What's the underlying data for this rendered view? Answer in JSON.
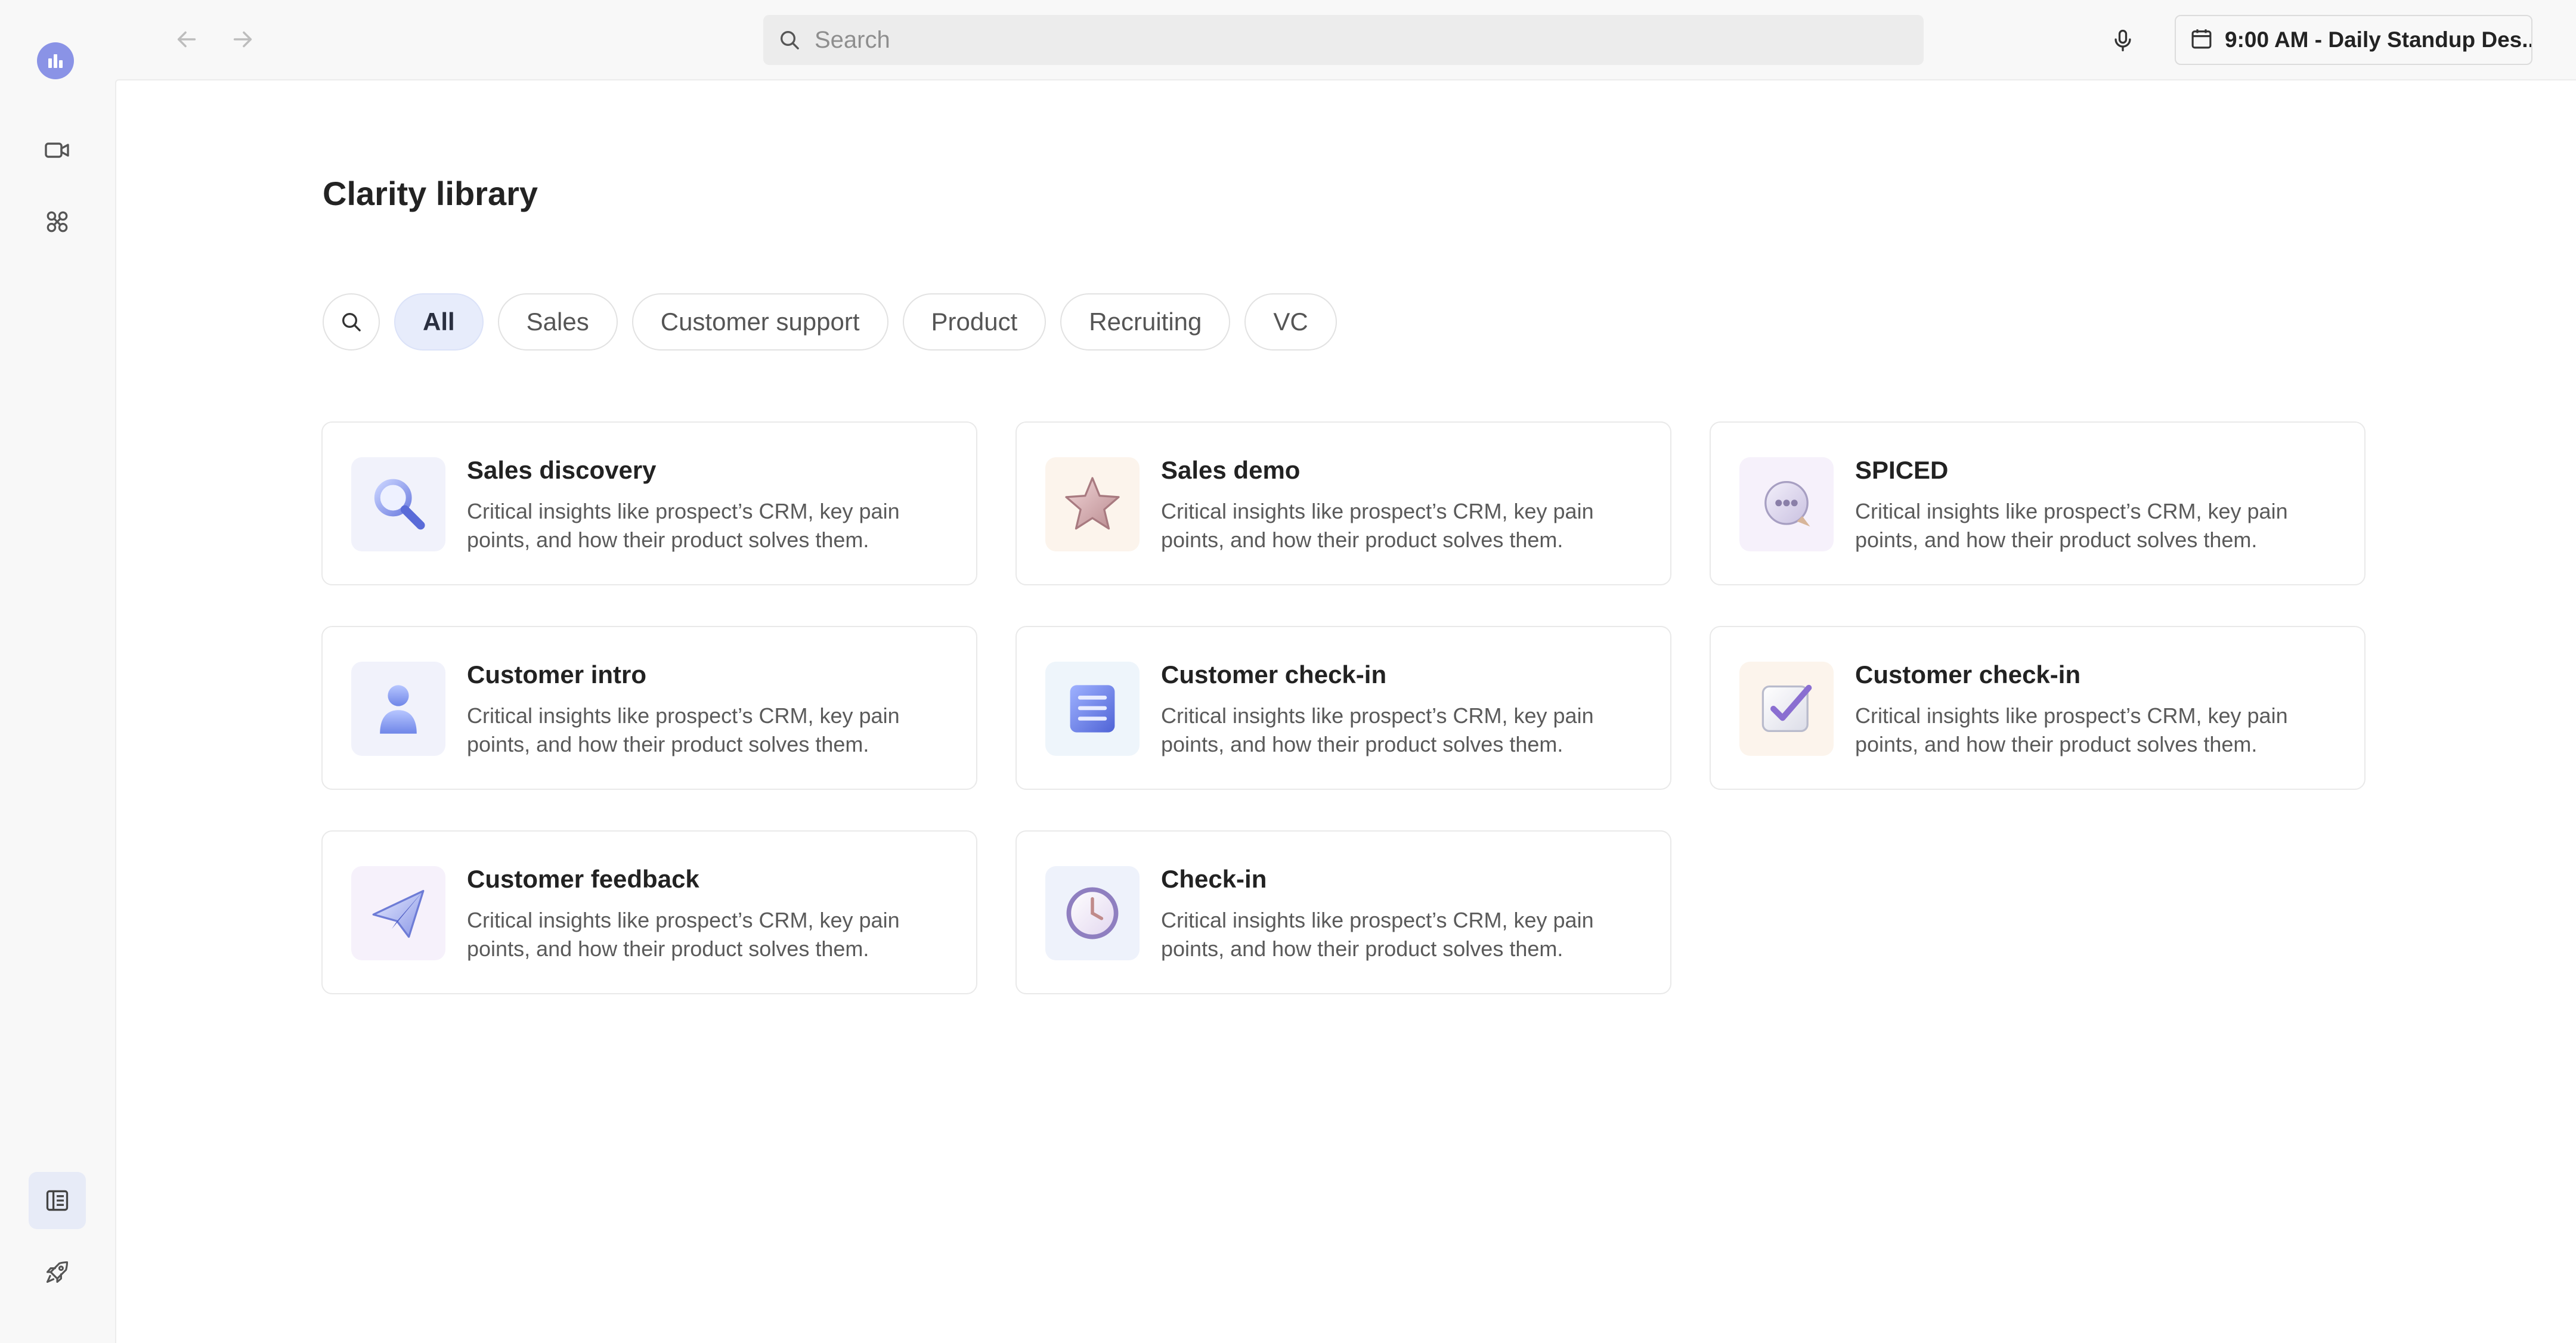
{
  "colors": {
    "accent": "#8a93e6",
    "chip_active_bg": "#e7ecfb",
    "surface": "#ffffff",
    "rail_bg": "#f8f8f8"
  },
  "rail": {
    "items": [
      {
        "icon": "app-logo-icon"
      },
      {
        "icon": "video-camera-icon"
      },
      {
        "icon": "integrations-icon"
      },
      {
        "icon": "library-icon",
        "active": true
      },
      {
        "icon": "rocket-icon"
      }
    ]
  },
  "topbar": {
    "search_placeholder": "Search",
    "meeting_label": "9:00 AM - Daily Standup Des.."
  },
  "page": {
    "title": "Clarity library"
  },
  "filters": [
    "All",
    "Sales",
    "Customer support",
    "Product",
    "Recruiting",
    "VC"
  ],
  "active_filter": "All",
  "cards": [
    {
      "title": "Sales discovery",
      "desc": "Critical insights like prospect’s CRM, key pain points, and how their product solves them.",
      "icon": "magnifier-icon",
      "tint": "#f1f2fb"
    },
    {
      "title": "Sales demo",
      "desc": "Critical insights like prospect’s CRM, key pain points, and how their product solves them.",
      "icon": "star-icon",
      "tint": "#fcf4ec"
    },
    {
      "title": "SPICED",
      "desc": "Critical insights like prospect’s CRM, key pain points, and how their product solves them.",
      "icon": "chat-bubble-icon",
      "tint": "#f6f1fb"
    },
    {
      "title": "Customer intro",
      "desc": "Critical insights like prospect’s CRM, key pain points, and how their product solves them.",
      "icon": "person-icon",
      "tint": "#f1f2fb"
    },
    {
      "title": "Customer check-in",
      "desc": "Critical insights like prospect’s CRM, key pain points, and how their product solves them.",
      "icon": "list-icon",
      "tint": "#eef5fb"
    },
    {
      "title": "Customer check-in",
      "desc": "Critical insights like prospect’s CRM, key pain points, and how their product solves them.",
      "icon": "checkbox-icon",
      "tint": "#fcf4ec"
    },
    {
      "title": "Customer feedback",
      "desc": "Critical insights like prospect’s CRM, key pain points, and how their product solves them.",
      "icon": "paper-plane-icon",
      "tint": "#f6f1fb"
    },
    {
      "title": "Check-in",
      "desc": "Critical insights like prospect’s CRM, key pain points, and how their product solves them.",
      "icon": "clock-icon",
      "tint": "#eef2fb"
    }
  ]
}
